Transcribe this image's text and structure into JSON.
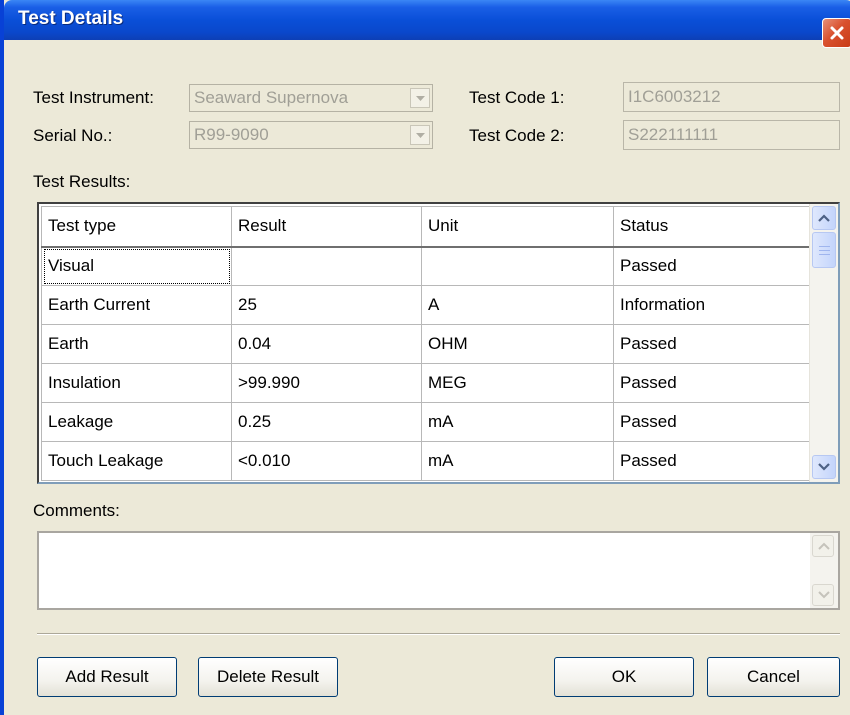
{
  "window": {
    "title": "Test Details",
    "close_icon": "close-icon"
  },
  "fields": {
    "test_instrument": {
      "label": "Test Instrument:",
      "value": "Seaward Supernova"
    },
    "serial_no": {
      "label": "Serial No.:",
      "value": "R99-9090"
    },
    "test_code_1": {
      "label": "Test Code 1:",
      "value": "I1C6003212"
    },
    "test_code_2": {
      "label": "Test Code 2:",
      "value": "S222111111"
    }
  },
  "results": {
    "label": "Test Results:",
    "columns": [
      "Test type",
      "Result",
      "Unit",
      "Status"
    ],
    "rows": [
      [
        "Visual",
        "",
        "",
        "Passed"
      ],
      [
        "Earth Current",
        "25",
        "A",
        "Information"
      ],
      [
        "Earth",
        "0.04",
        "OHM",
        "Passed"
      ],
      [
        "Insulation",
        ">99.990",
        "MEG",
        "Passed"
      ],
      [
        "Leakage",
        "0.25",
        "mA",
        "Passed"
      ],
      [
        "Touch Leakage",
        "<0.010",
        "mA",
        "Passed"
      ]
    ]
  },
  "comments": {
    "label": "Comments:",
    "value": ""
  },
  "buttons": {
    "add_result": "Add Result",
    "delete_result": "Delete Result",
    "ok": "OK",
    "cancel": "Cancel"
  },
  "colors": {
    "title_bar": "#0a4fd8",
    "window_bg": "#ece9d8",
    "close_button": "#d9512e"
  }
}
